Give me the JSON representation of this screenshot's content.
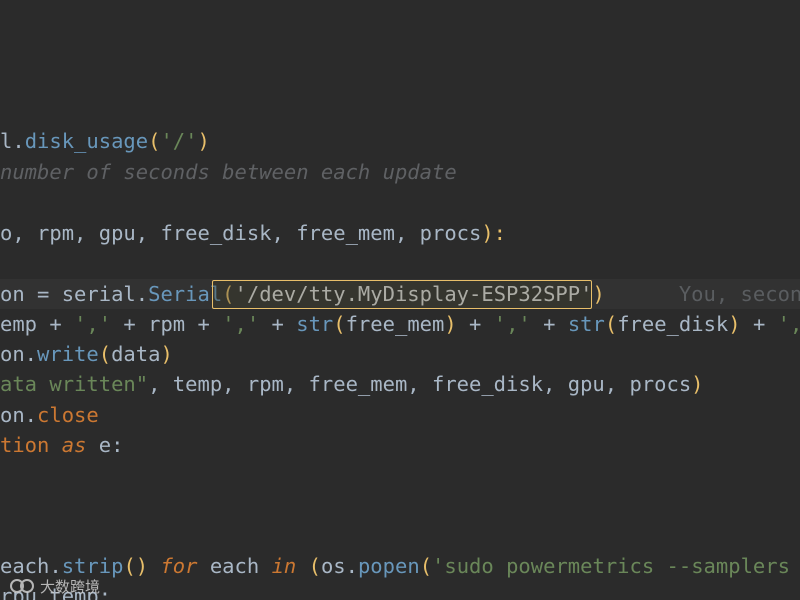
{
  "editor": {
    "lines": [
      {
        "id": "l1",
        "segments": [
          {
            "t": "l.",
            "c": "plain"
          },
          {
            "t": "disk_usage",
            "c": "fn"
          },
          {
            "t": "(",
            "c": "paren"
          },
          {
            "t": "'/'",
            "c": "str"
          },
          {
            "t": ")",
            "c": "paren"
          }
        ]
      },
      {
        "id": "l2",
        "segments": [
          {
            "t": "number of seconds between each update",
            "c": "cmt"
          }
        ]
      },
      {
        "id": "l3",
        "segments": [
          {
            "t": "o, rpm, gpu, free_disk, free_mem, procs",
            "c": "plain"
          },
          {
            "t": "):",
            "c": "paren"
          }
        ]
      },
      {
        "id": "l4",
        "segments": [
          {
            "t": "on = serial.",
            "c": "plain"
          },
          {
            "t": "Serial",
            "c": "cls"
          },
          {
            "t": "(",
            "c": "paren"
          },
          {
            "t": "'/dev/tty.MyDisplay-ESP32SPP'",
            "c": "str-bright"
          },
          {
            "t": ")",
            "c": "paren"
          },
          {
            "t": "      You, second",
            "c": "inlay"
          }
        ]
      },
      {
        "id": "l5",
        "segments": [
          {
            "t": "emp + ",
            "c": "plain"
          },
          {
            "t": "','",
            "c": "str"
          },
          {
            "t": " + rpm + ",
            "c": "plain"
          },
          {
            "t": "','",
            "c": "str"
          },
          {
            "t": " + ",
            "c": "plain"
          },
          {
            "t": "str",
            "c": "fn"
          },
          {
            "t": "(",
            "c": "paren"
          },
          {
            "t": "free_mem",
            "c": "plain"
          },
          {
            "t": ")",
            "c": "paren"
          },
          {
            "t": " + ",
            "c": "plain"
          },
          {
            "t": "','",
            "c": "str"
          },
          {
            "t": " + ",
            "c": "plain"
          },
          {
            "t": "str",
            "c": "fn"
          },
          {
            "t": "(",
            "c": "paren"
          },
          {
            "t": "free_disk",
            "c": "plain"
          },
          {
            "t": ")",
            "c": "paren"
          },
          {
            "t": " + ",
            "c": "plain"
          },
          {
            "t": "','",
            "c": "str"
          }
        ]
      },
      {
        "id": "l6",
        "segments": [
          {
            "t": "on.",
            "c": "plain"
          },
          {
            "t": "write",
            "c": "fn"
          },
          {
            "t": "(",
            "c": "paren"
          },
          {
            "t": "data",
            "c": "plain"
          },
          {
            "t": ")",
            "c": "paren"
          }
        ]
      },
      {
        "id": "l7",
        "segments": [
          {
            "t": "ata written\"",
            "c": "str"
          },
          {
            "t": ", temp, rpm, free_mem, free_disk, gpu, procs",
            "c": "plain"
          },
          {
            "t": ")",
            "c": "paren"
          }
        ]
      },
      {
        "id": "l8",
        "segments": [
          {
            "t": "on.",
            "c": "plain"
          },
          {
            "t": "close",
            "c": "kw"
          }
        ]
      },
      {
        "id": "l9",
        "segments": [
          {
            "t": "tion ",
            "c": "kw"
          },
          {
            "t": "as",
            "c": "kwi"
          },
          {
            "t": " e:",
            "c": "plain"
          }
        ]
      },
      {
        "id": "l10",
        "segments": [
          {
            "t": "each.",
            "c": "plain"
          },
          {
            "t": "strip",
            "c": "fn"
          },
          {
            "t": "() ",
            "c": "paren"
          },
          {
            "t": "for",
            "c": "kwi"
          },
          {
            "t": " each ",
            "c": "plain"
          },
          {
            "t": "in",
            "c": "kwi"
          },
          {
            "t": " (",
            "c": "paren"
          },
          {
            "t": "os.",
            "c": "plain"
          },
          {
            "t": "popen",
            "c": "fn"
          },
          {
            "t": "(",
            "c": "paren"
          },
          {
            "t": "'sudo powermetrics --samplers sm",
            "c": "str"
          }
        ]
      },
      {
        "id": "l11",
        "segments": [
          {
            "t": "rpu_temp:",
            "c": "plain"
          }
        ]
      }
    ]
  },
  "watermark": {
    "text": "大数跨境"
  },
  "colors": {
    "background": "#2b2b2b",
    "current_line": "#323232",
    "highlight_border": "#e8bf6a"
  }
}
